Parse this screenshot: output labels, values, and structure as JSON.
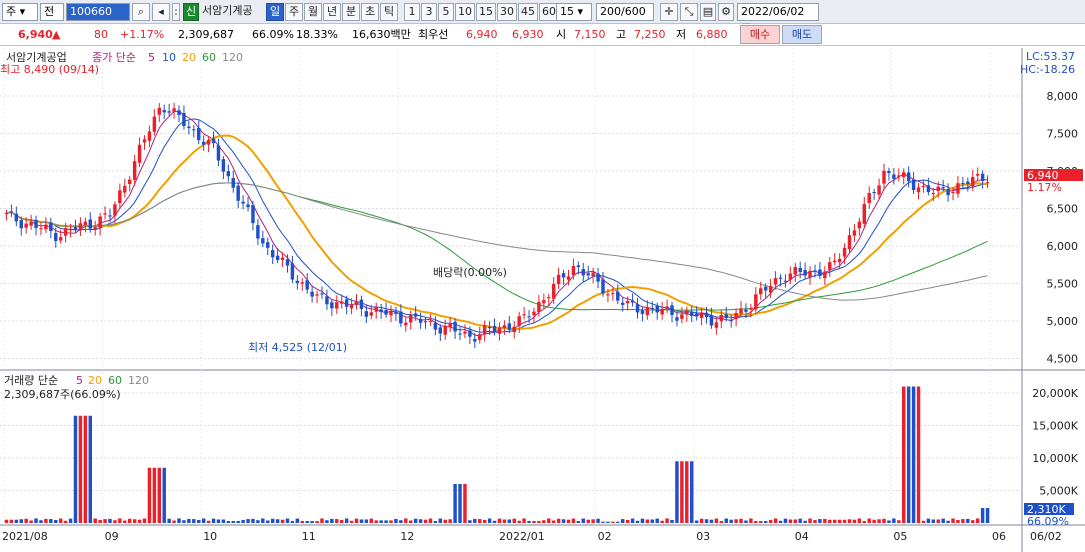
{
  "toolbar": {
    "market_combo": "주",
    "all_label": "전",
    "stock_code": "100660",
    "market_badge": "신",
    "stock_name": "서암기계공",
    "periods": [
      "일",
      "주",
      "월",
      "년",
      "분",
      "초",
      "틱"
    ],
    "minute_values": [
      "1",
      "3",
      "5",
      "10",
      "15",
      "30",
      "45",
      "60"
    ],
    "interval_value": "15",
    "count_value": "200",
    "count_total": "/600",
    "date_value": "2022/06/02"
  },
  "quote": {
    "price": "6,940",
    "change_arrow": "▲",
    "change": "80",
    "change_pct": "+1.17%",
    "volume": "2,309,687",
    "volume_ratio": "66.09%",
    "turnover": "18.33%",
    "amount": "16,630백만",
    "best_label": "최우선",
    "best_ask": "6,940",
    "best_bid": "6,930",
    "open_label": "시",
    "open": "7,150",
    "high_label": "고",
    "high": "7,250",
    "low_label": "저",
    "low": "6,880",
    "buy_button": "매수",
    "sell_button": "매도"
  },
  "price_panel": {
    "title": "서암기계공업",
    "ma_label": "종가 단순",
    "ma_periods": [
      "5",
      "10",
      "20",
      "60",
      "120"
    ],
    "lc": "LC:53.37",
    "hc": "HC:-18.26",
    "high_annotation": "최고 8,490 (09/14)",
    "low_annotation": "최저 4,525 (12/01)",
    "dividend_annotation": "배당락(0.00%)",
    "current_price_tag": "6,940",
    "current_pct_tag": "1.17%",
    "y_ticks": [
      "8,000",
      "7,500",
      "7,000",
      "6,500",
      "6,000",
      "5,500",
      "5,000",
      "4,500"
    ]
  },
  "volume_panel": {
    "title": "거래량 단순",
    "ma_periods": [
      "5",
      "20",
      "60",
      "120"
    ],
    "current_volume": "2,309,687주(66.09%)",
    "y_ticks": [
      "20,000K",
      "15,000K",
      "10,000K",
      "5,000K"
    ],
    "current_tag": "2,310K",
    "current_pct": "66.09%"
  },
  "x_axis": [
    "2021/08",
    "09",
    "10",
    "11",
    "12",
    "2022/01",
    "02",
    "03",
    "04",
    "05",
    "06",
    "06/02"
  ],
  "colors": {
    "up": "#e8212a",
    "down": "#1f50c8",
    "ma5": "#b0207f",
    "ma10": "#1f50c8",
    "ma20": "#f0a000",
    "ma60": "#2e9a3a",
    "ma120": "#888888"
  },
  "chart_data": [
    {
      "type": "candlestick",
      "title": "서암기계공업",
      "x": [
        "2021/08",
        "09",
        "10",
        "11",
        "12",
        "2022/01",
        "02",
        "03",
        "04",
        "05",
        "06"
      ],
      "close": [
        6400,
        6150,
        6400,
        7900,
        7300,
        6000,
        5300,
        5150,
        5000,
        4800,
        5000,
        5750,
        5200,
        5100,
        5000,
        5600,
        5700,
        7000,
        6700,
        6940
      ],
      "ylim": [
        4400,
        8400
      ],
      "annotations": [
        "최고 8,490 (09/14)",
        "최저 4,525 (12/01)",
        "배당락(0.00%)"
      ]
    },
    {
      "type": "bar",
      "title": "거래량",
      "unit": "K",
      "values": [
        500,
        16500,
        8500,
        300,
        300,
        400,
        6000,
        300,
        200,
        9500,
        300,
        500,
        21000,
        2310
      ],
      "ylim": [
        0,
        22000
      ]
    }
  ]
}
